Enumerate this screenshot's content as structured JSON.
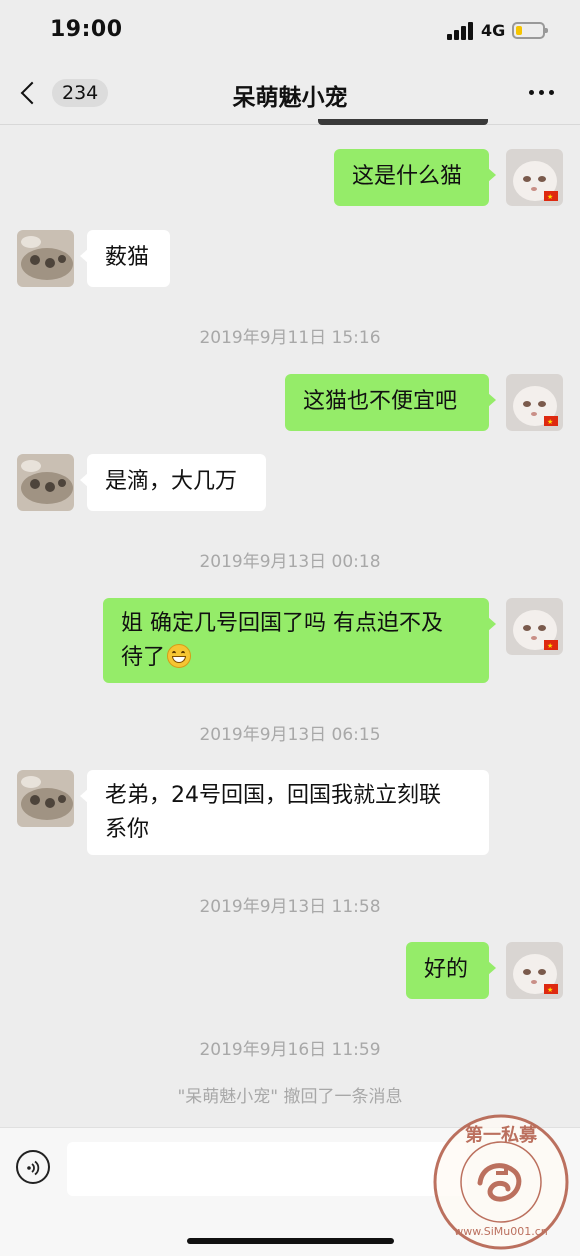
{
  "status_bar": {
    "time": "19:00",
    "network": "4G"
  },
  "nav": {
    "unread_count": "234",
    "title": "呆萌魅小宠"
  },
  "messages": [
    {
      "side": "me",
      "text": "这是什么猫"
    },
    {
      "side": "other",
      "text": "薮猫"
    },
    {
      "type": "time",
      "text": "2019年9月11日 15:16"
    },
    {
      "side": "me",
      "text": "这猫也不便宜吧"
    },
    {
      "side": "other",
      "text": "是滴，大几万"
    },
    {
      "type": "time",
      "text": "2019年9月13日 00:18"
    },
    {
      "side": "me",
      "text": "姐 确定几号回国了吗 有点迫不及待了",
      "emoji": "grinning-face-icon"
    },
    {
      "type": "time",
      "text": "2019年9月13日 06:15"
    },
    {
      "side": "other",
      "text": "老弟，24号回国，回国我就立刻联系你"
    },
    {
      "type": "time",
      "text": "2019年9月13日 11:58"
    },
    {
      "side": "me",
      "text": "好的"
    },
    {
      "type": "time",
      "text": "2019年9月16日 11:59"
    },
    {
      "type": "system",
      "text": "\"呆萌魅小宠\" 撤回了一条消息"
    }
  ],
  "m": {
    "m1": "这是什么猫",
    "m2": "薮猫",
    "t1": "2019年9月11日 15:16",
    "m3": "这猫也不便宜吧",
    "m4": "是滴，大几万",
    "t2": "2019年9月13日 00:18",
    "m5a": "姐 确定几号回国了吗 有点迫不及",
    "m5b": "待了",
    "t3": "2019年9月13日 06:15",
    "m6a": "老弟，24号回国，回国我就立刻联",
    "m6b": "系你",
    "t4": "2019年9月13日 11:58",
    "m7": "好的",
    "t5": "2019年9月16日 11:59",
    "sys": "\"呆萌魅小宠\" 撤回了一条消息"
  },
  "watermark": {
    "top_text": "第一私募",
    "bottom_text": "www.SiMu001.cn"
  },
  "colors": {
    "my_bubble": "#95ec69",
    "other_bubble": "#ffffff",
    "background": "#ededed"
  }
}
